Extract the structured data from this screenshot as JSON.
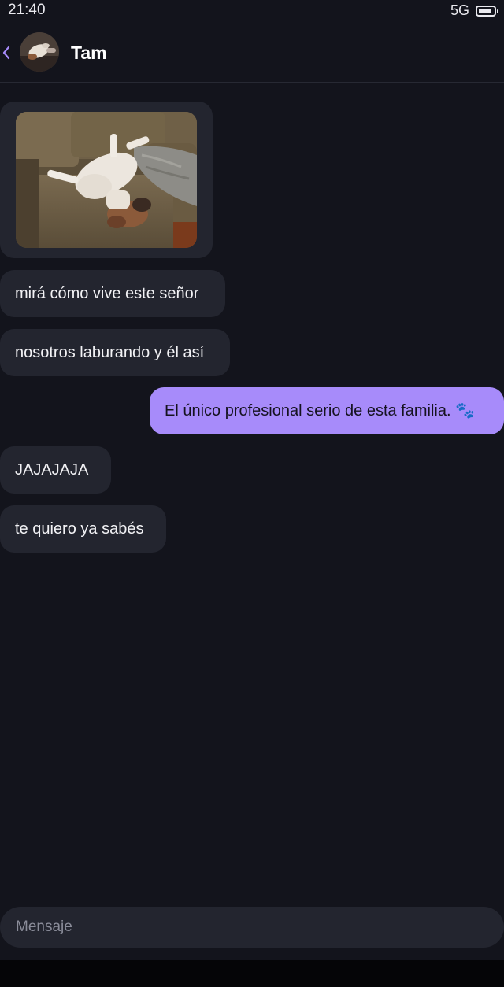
{
  "status_bar": {
    "time": "21:40",
    "network": "5G",
    "battery_level": 0.85
  },
  "header": {
    "back_icon": "chevron-left-icon",
    "contact_name": "Tam",
    "avatar_icon": "dog-photo-avatar"
  },
  "messages": [
    {
      "type": "image",
      "direction": "in",
      "image": "dog-sleeping-on-couch-photo"
    },
    {
      "type": "text",
      "direction": "in",
      "text": "mirá cómo vive este señor"
    },
    {
      "type": "text",
      "direction": "in",
      "text": "nosotros laburando y él así"
    },
    {
      "type": "text",
      "direction": "out",
      "text": "El único profesional serio de esta familia. 🐾"
    },
    {
      "type": "text",
      "direction": "in",
      "text": "JAJAJAJA"
    },
    {
      "type": "text",
      "direction": "in",
      "text": "te quiero ya sabés"
    }
  ],
  "composer": {
    "placeholder": "Mensaje",
    "value": ""
  },
  "colors": {
    "background": "#13141c",
    "incoming_bubble": "#23252f",
    "outgoing_bubble": "#a78bfa",
    "accent": "#a78bfa"
  }
}
